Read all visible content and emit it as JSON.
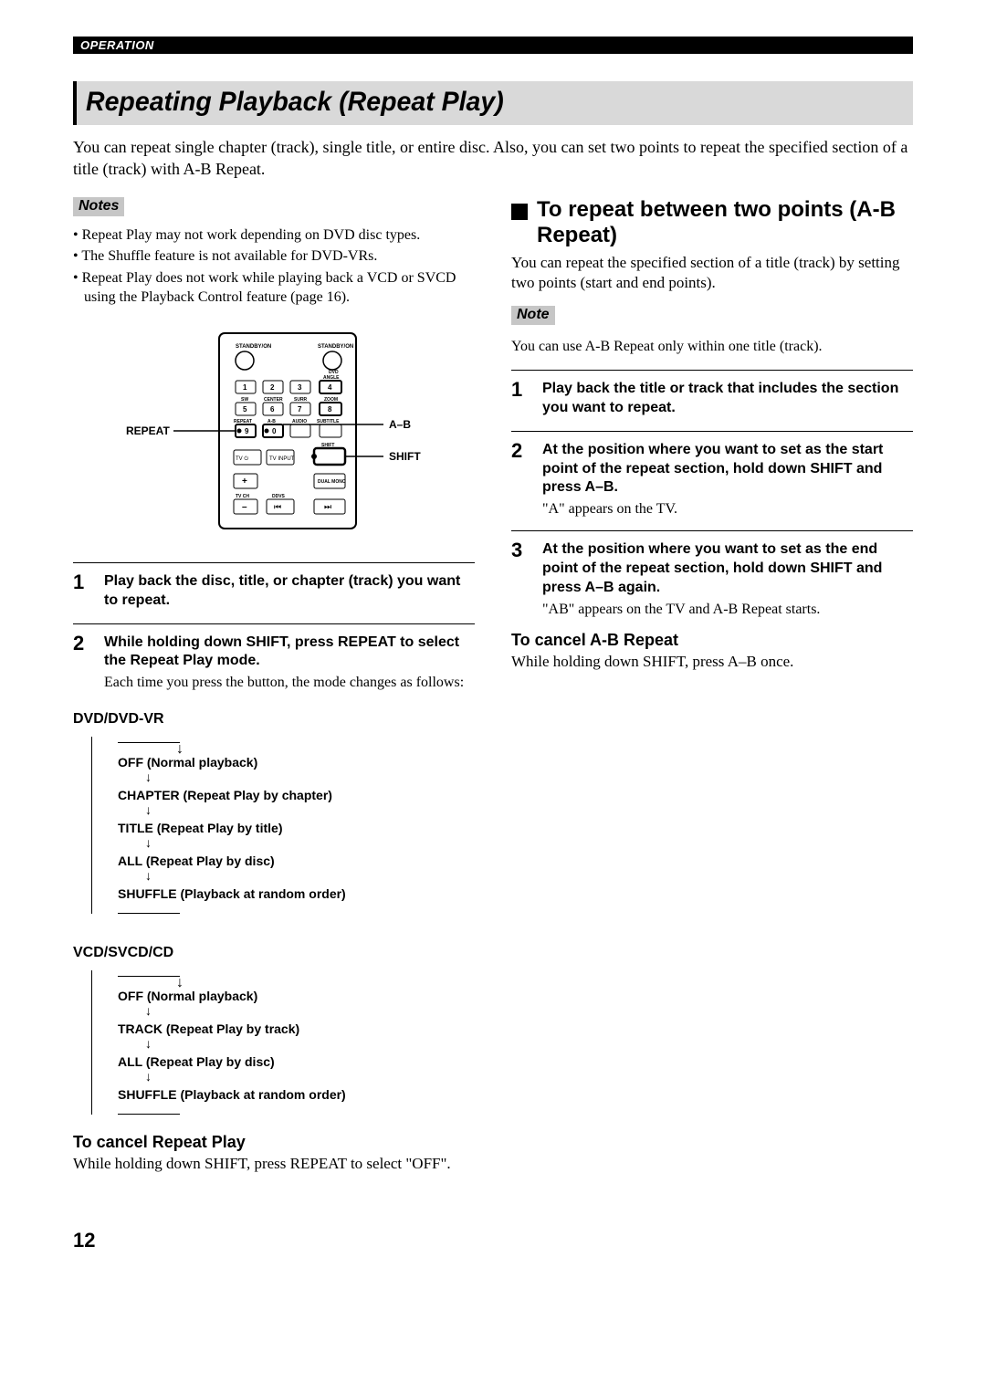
{
  "header": {
    "section": "OPERATION"
  },
  "title": "Repeating Playback (Repeat Play)",
  "intro": "You can repeat single chapter (track), single title, or entire disc. Also, you can set two points to repeat the specified section of a title (track) with A-B Repeat.",
  "left": {
    "notes_label": "Notes",
    "notes": [
      "Repeat Play may not work depending on DVD disc types.",
      "The Shuffle feature is not available for DVD-VRs.",
      "Repeat Play does not work while playing back a VCD or SVCD using the Playback Control feature (page 16)."
    ],
    "remote_labels": {
      "repeat": "REPEAT",
      "ab": "A–B",
      "shift": "SHIFT"
    },
    "steps": [
      {
        "num": "1",
        "title": "Play back the disc, title, or chapter (track) you want to repeat.",
        "desc": ""
      },
      {
        "num": "2",
        "title": "While holding down SHIFT, press REPEAT to select the Repeat Play mode.",
        "desc": "Each time you press the button, the mode changes as follows:"
      }
    ],
    "mode_dvd_label": "DVD/DVD-VR",
    "mode_dvd": [
      "OFF (Normal playback)",
      "CHAPTER (Repeat Play by chapter)",
      "TITLE (Repeat Play by title)",
      "ALL (Repeat Play by disc)",
      "SHUFFLE (Playback at random order)"
    ],
    "mode_vcd_label": "VCD/SVCD/CD",
    "mode_vcd": [
      "OFF (Normal playback)",
      "TRACK (Repeat Play by track)",
      "ALL (Repeat Play by disc)",
      "SHUFFLE (Playback at random order)"
    ],
    "cancel_heading": "To cancel Repeat Play",
    "cancel_text": "While holding down SHIFT, press REPEAT to select \"OFF\"."
  },
  "right": {
    "heading": "To repeat between two points (A-B Repeat)",
    "intro": "You can repeat the specified section of a title (track) by setting two points (start and end points).",
    "note_label": "Note",
    "note_text": "You can use A-B Repeat only within one title (track).",
    "steps": [
      {
        "num": "1",
        "title": "Play back the title or track that includes the section you want to repeat.",
        "desc": ""
      },
      {
        "num": "2",
        "title": "At the position where you want to set as the start point of the repeat section, hold down SHIFT and press A–B.",
        "desc": "\"A\" appears on the TV."
      },
      {
        "num": "3",
        "title": "At the position where you want to set as the end point of the repeat section, hold down SHIFT and press A–B again.",
        "desc": "\"AB\" appears on the TV and A-B Repeat starts."
      }
    ],
    "cancel_heading": "To cancel A-B Repeat",
    "cancel_text": "While holding down SHIFT, press A–B once."
  },
  "page": "12"
}
